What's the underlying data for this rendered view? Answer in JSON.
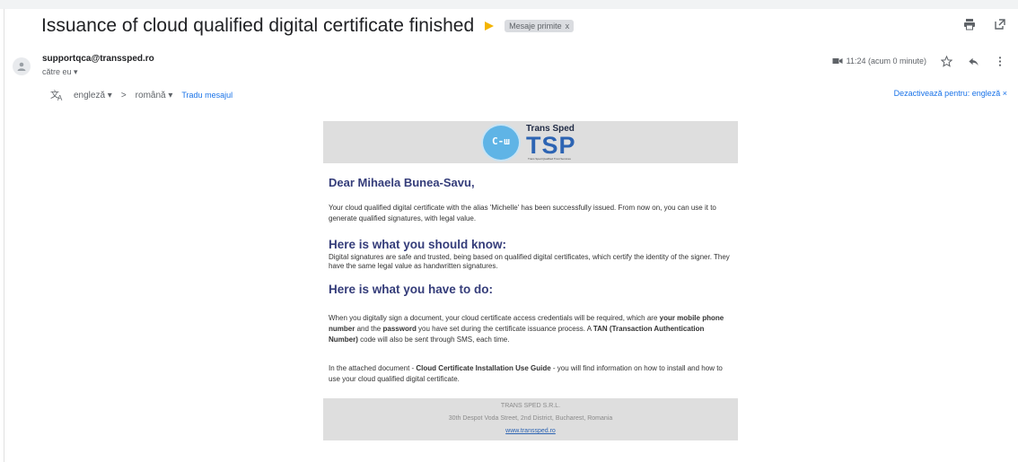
{
  "message": {
    "subject": "Issuance of cloud qualified digital certificate finished",
    "label": "Mesaje primite",
    "label_close": "x",
    "sender": "supportqca@transsped.ro",
    "recipient_line": "către eu ▾",
    "time": "11:24 (acum 0 minute)"
  },
  "translate": {
    "from_lang": "engleză ▾",
    "arrow": ">",
    "to_lang": "română ▾",
    "action": "Tradu mesajul",
    "disable": "Dezactivează pentru: engleză ×"
  },
  "email": {
    "logo_brand": "Trans Sped",
    "logo_mark": "TSP",
    "logo_key": "C-ш",
    "logo_tagline": "Trans Sped Qualified Trust Services",
    "greeting": "Dear Mihaela Bunea-Savu,",
    "p1": "Your cloud qualified digital certificate with the alias 'Michelle' has been successfully issued. From now on, you can use it to generate qualified signatures, with legal value.",
    "h_know": "Here is what you should know:",
    "p2": "Digital signatures are safe and trusted, being based on qualified digital certificates, which certify the identity of the signer. They have the same legal value as handwritten signatures.",
    "h_do": "Here is what you have to do:",
    "p3_a": "When you digitally sign a document, your cloud certificate access credentials will be required, which are ",
    "p3_b": "your mobile phone number",
    "p3_c": " and the ",
    "p3_d": "password",
    "p3_e": " you have set during the certificate issuance process. A ",
    "p3_f": "TAN (Transaction Authentication Number)",
    "p3_g": " code will also be sent through SMS, each time.",
    "p4_a": "In the attached document - ",
    "p4_b": "Cloud Certificate Installation Use Guide",
    "p4_c": " - you will find information on how to install and how to use your cloud qualified digital certificate.",
    "footer_company": "TRANS SPED S.R.L.",
    "footer_address": "30th Despot Voda Street, 2nd District, Bucharest, Romania",
    "footer_link": "www.transsped.ro"
  },
  "icons": {
    "print": "print-icon",
    "popout": "open-in-new-window-icon",
    "label": "label-close-icon",
    "video": "video-icon",
    "star": "star-icon",
    "reply": "reply-icon",
    "more": "more-vertical-icon",
    "translate": "translate-icon",
    "avatar": "person-icon"
  },
  "colors": {
    "heading": "#353d7a",
    "link": "#1a73e8",
    "banner_bg": "#dedede",
    "logo_blue": "#2d64b3",
    "important": "#f4b400"
  }
}
